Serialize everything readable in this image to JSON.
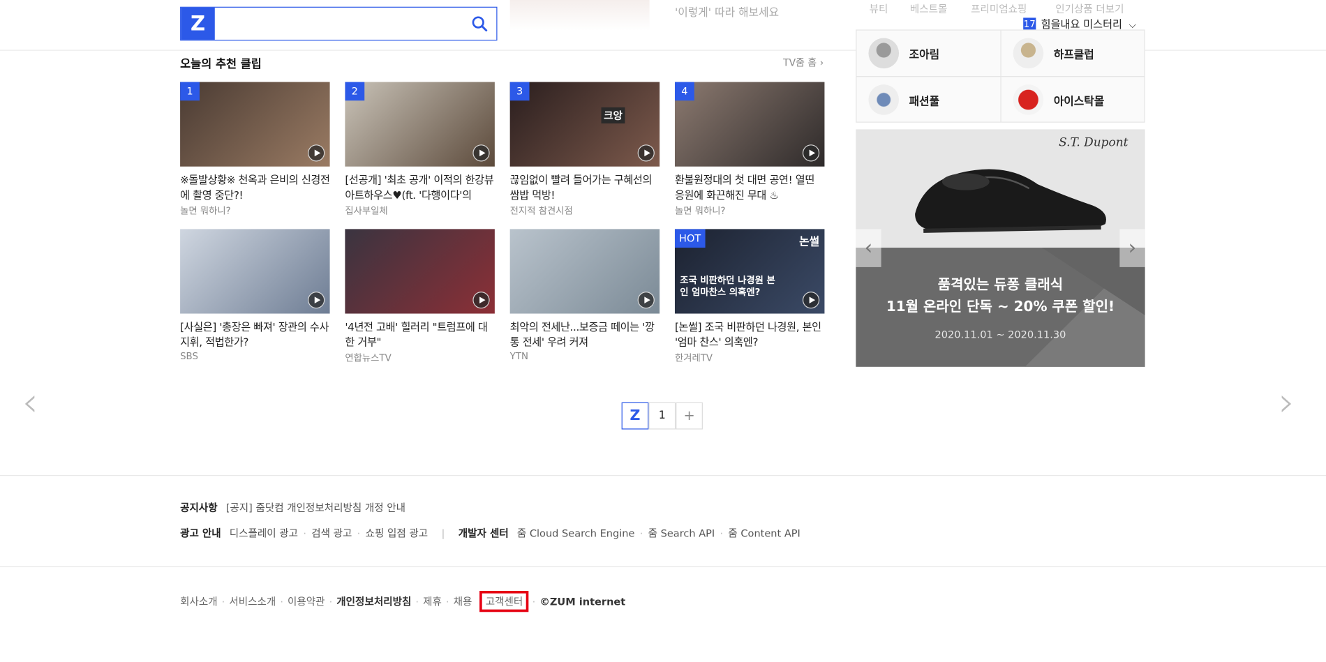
{
  "header": {
    "search_placeholder": "",
    "logo": "Z",
    "faded_caption": "'이렇게' 따라 해보세요",
    "shop_tabs": [
      "뷰티",
      "베스트몰",
      "프리미엄쇼핑",
      "인기상품 더보기"
    ],
    "weather_num": "17",
    "weather_text": "힘을내요 미스터리"
  },
  "section": {
    "title": "오늘의 추천 클립",
    "more": "TV줌 홈 ›"
  },
  "clips": [
    {
      "badge": "1",
      "title": "※돌발상황※ 천옥과 은비의 신경전에 촬영 중단?!",
      "src": "놀면 뭐하니?",
      "color1": "#4a3b33",
      "color2": "#9a7b63"
    },
    {
      "badge": "2",
      "title": "[선공개] '최초 공개' 이적의 한강뷰 아트하우스♥(ft. '다행이다'의",
      "src": "집사부일체",
      "color1": "#c9c3b8",
      "color2": "#5c4a3b"
    },
    {
      "badge": "3",
      "title": "끊임없이 빨려 들어가는 구혜선의 쌈밥 먹방!",
      "src": "전지적 참견시점",
      "color1": "#2a1e1e",
      "color2": "#7d5a4c"
    },
    {
      "badge": "4",
      "title": "환불원정대의 첫 대면 공연! 열띤 응원에 화끈해진 무대 ♨",
      "src": "놀면 뭐하니?",
      "color1": "#8c7a70",
      "color2": "#2e2a2a"
    },
    {
      "badge": "",
      "title": "[사실은] '총장은 빠져' 장관의 수사 지휘, 적법한가?",
      "src": "SBS",
      "color1": "#cfd6e0",
      "color2": "#6e7d94"
    },
    {
      "badge": "",
      "title": "'4년전 고배' 힐러리 \"트럼프에 대한 거부\"",
      "src": "연합뉴스TV",
      "color1": "#3a3440",
      "color2": "#8c2f36"
    },
    {
      "badge": "",
      "title": "최악의 전세난...보증금 떼이는 '깡통 전세' 우려 커져",
      "src": "YTN",
      "color1": "#b9c3cc",
      "color2": "#7b8a96"
    },
    {
      "badge": "HOT",
      "title": "[논썰] 조국 비판하던 나경원, 본인 '엄마 찬스' 의혹엔?",
      "src": "한겨레TV",
      "color1": "#1c2230",
      "color2": "#3b4a66"
    }
  ],
  "clip4_overlay": "조국 비판하던 나경원 본인 엄마찬스 의혹엔?",
  "clip4_tag": "논썰",
  "clip3_tag": "크앙",
  "shop": {
    "items": [
      "조아림",
      "하프클럽",
      "패션풀",
      "아이스탁몰"
    ],
    "colors": [
      "#b8b8b8",
      "#c9b8a0",
      "#7e98c2",
      "#d8231f"
    ]
  },
  "ad": {
    "brand": "S.T. Dupont",
    "line1": "품격있는 듀퐁 클래식",
    "line2": "11월 온라인 단독 ~ 20% 쿠폰 할인!",
    "date": "2020.11.01 ~ 2020.11.30"
  },
  "pager": {
    "z": "Z",
    "page": "1",
    "plus": "+"
  },
  "footer": {
    "notice_label": "공지사항",
    "notice_text": "[공지] 줌닷컴 개인정보처리방침 개정 안내",
    "ad_label": "광고 안내",
    "ad_links": [
      "디스플레이 광고",
      "검색 광고",
      "쇼핑 입점 광고"
    ],
    "dev_label": "개발자 센터",
    "dev_links": [
      "줌 Cloud Search Engine",
      "줌 Search API",
      "줌 Content API"
    ],
    "bottom_links": [
      "회사소개",
      "서비스소개",
      "이용약관",
      "개인정보처리방침",
      "제휴",
      "채용",
      "고객센터"
    ],
    "copyright": "©ZUM internet"
  }
}
